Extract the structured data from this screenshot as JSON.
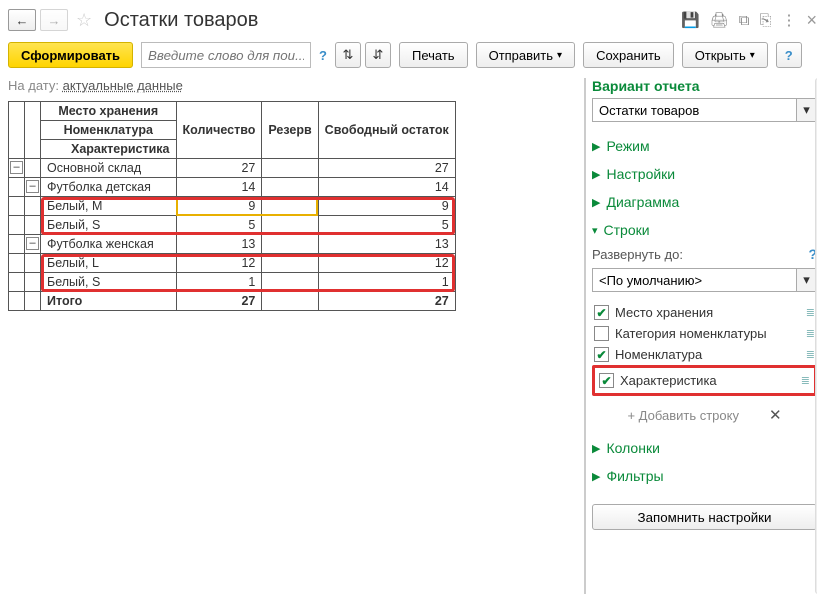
{
  "header": {
    "title": "Остатки товаров"
  },
  "toolbar": {
    "generate": "Сформировать",
    "search_placeholder": "Введите слово для пои...",
    "print": "Печать",
    "send": "Отправить",
    "save": "Сохранить",
    "open": "Открыть"
  },
  "date_row": {
    "label": "На дату:",
    "value": "актуальные данные"
  },
  "table": {
    "headers": {
      "place": "Место хранения",
      "nomenclature": "Номенклатура",
      "characteristic": "Характеристика",
      "qty": "Количество",
      "reserve": "Резерв",
      "free": "Свободный остаток",
      "total": "Итого"
    },
    "rows": [
      {
        "level": 0,
        "label": "Основной склад",
        "qty": "27",
        "reserve": "",
        "free": "27"
      },
      {
        "level": 1,
        "label": "Футболка детская",
        "qty": "14",
        "reserve": "",
        "free": "14"
      },
      {
        "level": 2,
        "label": "Белый, M",
        "qty": "9",
        "reserve": "",
        "free": "9"
      },
      {
        "level": 2,
        "label": "Белый, S",
        "qty": "5",
        "reserve": "",
        "free": "5"
      },
      {
        "level": 1,
        "label": "Футболка женская",
        "qty": "13",
        "reserve": "",
        "free": "13"
      },
      {
        "level": 2,
        "label": "Белый, L",
        "qty": "12",
        "reserve": "",
        "free": "12"
      },
      {
        "level": 2,
        "label": "Белый, S",
        "qty": "1",
        "reserve": "",
        "free": "1"
      }
    ],
    "total_row": {
      "label": "Итого",
      "qty": "27",
      "reserve": "",
      "free": "27"
    }
  },
  "right": {
    "variant_title": "Вариант отчета",
    "variant_value": "Остатки товаров",
    "sections": {
      "mode": "Режим",
      "settings": "Настройки",
      "diagram": "Диаграмма",
      "rows": "Строки",
      "columns": "Колонки",
      "filters": "Фильтры"
    },
    "rows_panel": {
      "expand_label": "Развернуть до:",
      "expand_value": "<По умолчанию>",
      "items": [
        {
          "checked": true,
          "label": "Место хранения"
        },
        {
          "checked": false,
          "label": "Категория номенклатуры"
        },
        {
          "checked": true,
          "label": "Номенклатура"
        },
        {
          "checked": true,
          "label": "Характеристика"
        }
      ],
      "add_row": "+ Добавить строку"
    },
    "save_settings": "Запомнить настройки"
  }
}
